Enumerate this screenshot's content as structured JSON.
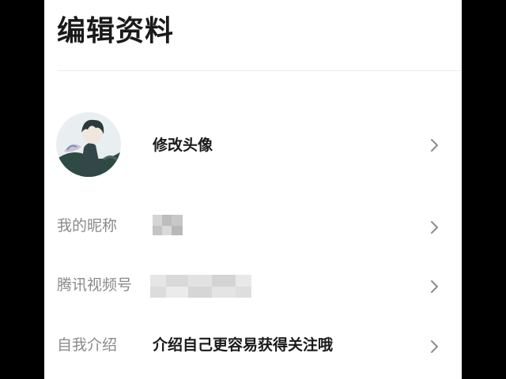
{
  "header": {
    "title": "编辑资料"
  },
  "profile": {
    "avatar_label": "修改头像",
    "nickname_label": "我的昵称",
    "video_id_label": "腾讯视频号",
    "intro_label": "自我介绍",
    "intro_placeholder": "介绍自己更容易获得关注哦"
  },
  "icons": {
    "row_arrow": "chevron-right-icon"
  },
  "colors": {
    "label": "#8a8a8a",
    "value": "#1a1a1a",
    "chevron": "#8c8c8c",
    "background": "#ffffff"
  }
}
